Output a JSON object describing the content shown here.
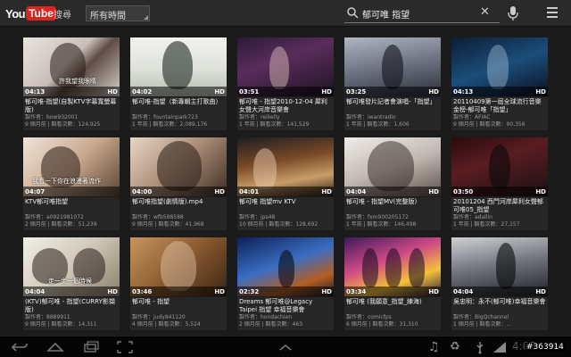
{
  "header": {
    "logo_you": "You",
    "logo_tube": "Tube",
    "search_label": "搜尋",
    "time_filter": "所有時間",
    "query": "郁可唯 指望"
  },
  "videos": [
    {
      "title": "郁可唯-指望(自製KTV字幕寬螢幕版)",
      "uploader": "製作者：bow932001",
      "stats": "9 個月前 | 觀看次數：124,925",
      "duration": "04:13",
      "hd": "HD",
      "caption": "許我望我眼睛"
    },
    {
      "title": "郁可唯-指望（新專輯主打歌曲）",
      "uploader": "製作者：fountainpark723",
      "stats": "1 年前 | 觀看次數：2,089,176",
      "duration": "04:02",
      "hd": "HD",
      "caption": ""
    },
    {
      "title": "郁可唯 - 指望2010-12-04 犀利女聲大河岸音樂會",
      "uploader": "製作者：reikelly",
      "stats": "1 年前 | 觀看次數：141,529",
      "duration": "03:51",
      "hd": "HD",
      "caption": ""
    },
    {
      "title": "郁可唯發片記者會演唱-「指望」",
      "uploader": "製作者：iwantradio",
      "stats": "1 年前 | 觀看次數：1,606",
      "duration": "03:25",
      "hd": "HD",
      "caption": ""
    },
    {
      "title": "20110409第一屆全球流行音樂金榜-郁可唯「指望」",
      "uploader": "製作者：AFIAC",
      "stats": "9 個月前 | 觀看次數：90,356",
      "duration": "04:13",
      "hd": "HD",
      "caption": ""
    },
    {
      "title": "KTV郁可唯指望",
      "uploader": "製作者：a0921981072",
      "stats": "2 個月前 | 觀看次數：51,239",
      "duration": "04:07",
      "hd": "",
      "caption": "我看一下你在浪漫著流作"
    },
    {
      "title": "郁可唯指望(劇情版).mp4",
      "uploader": "製作者：wfb588588",
      "stats": "9 個月前 | 觀看次數：41,968",
      "duration": "04:00",
      "hd": "HD",
      "caption": ""
    },
    {
      "title": "郁可唯 指望mv KTV",
      "uploader": "製作者：jps48",
      "stats": "10 個月前 | 觀看次數：128,692",
      "duration": "04:01",
      "hd": "HD",
      "caption": ""
    },
    {
      "title": "郁可唯 - 指望MV(完整版)",
      "uploader": "製作者：fxm900205172",
      "stats": "1 年前 | 觀看次數：146,498",
      "duration": "04:04",
      "hd": "HD",
      "caption": ""
    },
    {
      "title": "20101204 西門河岸犀利女聲郁可唯05_指望",
      "uploader": "製作者：adallin",
      "stats": "1 年前 | 觀看次數：27,157",
      "duration": "03:50",
      "hd": "HD",
      "caption": ""
    },
    {
      "title": "(KTV)郁可唯 - 指望(CURRY影擷版)",
      "uploader": "製作者：8889911",
      "stats": "9 個月前 | 觀看次數：14,311",
      "duration": "04:04",
      "hd": "HD",
      "caption": "走一步一個時候"
    },
    {
      "title": "郁可唯 - 指望",
      "uploader": "製作者：judy841120",
      "stats": "4 個月前 | 觀看次數：5,524",
      "duration": "03:46",
      "hd": "HD",
      "caption": ""
    },
    {
      "title": "Dreams 郁可唯@Legacy Taipei 指望 幸福音樂會",
      "uploader": "製作者：hondachien",
      "stats": "2 個月前 | 觀看次數：463",
      "duration": "02:32",
      "hd": "HD",
      "caption": ""
    },
    {
      "title": "郁可唯 (我願意_指望_練海)",
      "uploader": "製作者：comicfps",
      "stats": "6 個月前 | 觀看次數：31,310",
      "duration": "03:34",
      "hd": "HD",
      "caption": ""
    },
    {
      "title": "吳忠明：永不(郁可唯)幸福音樂會",
      "uploader": "製作者：BigQchannel",
      "stats": "1 個月前 | 觀看次數：...",
      "duration": "04:04",
      "hd": "HD",
      "caption": ""
    }
  ],
  "statusbar": {
    "clock": "4:03",
    "watermark": "#363914"
  }
}
